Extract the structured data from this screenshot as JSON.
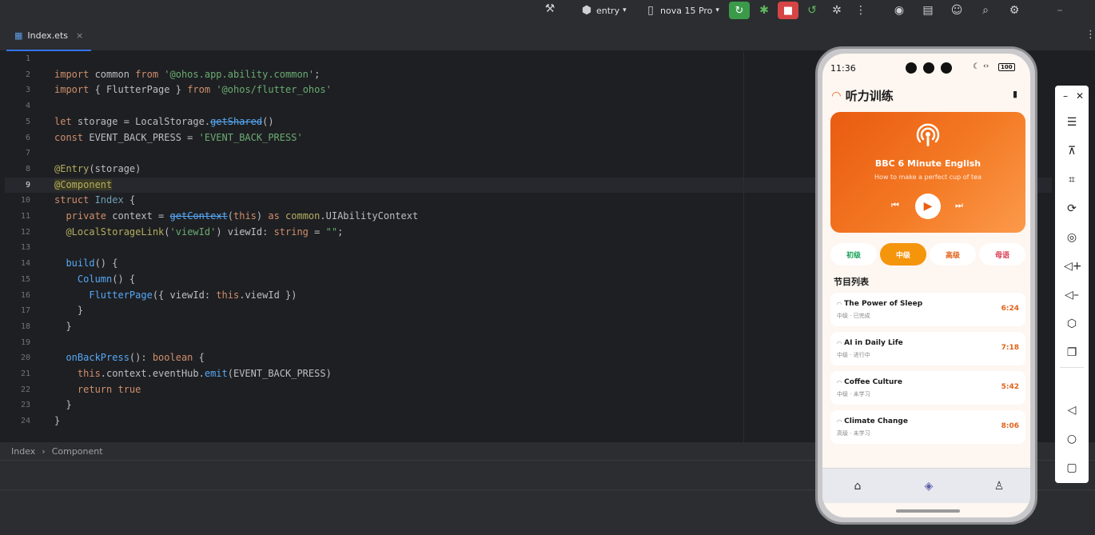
{
  "toolbar": {
    "module": "entry",
    "device": "nova 15 Pro"
  },
  "tab": {
    "filename": "Index.ets",
    "close": "×"
  },
  "gutter": [
    "1",
    "2",
    "3",
    "4",
    "5",
    "6",
    "7",
    "8",
    "9",
    "10",
    "11",
    "12",
    "13",
    "14",
    "15",
    "16",
    "17",
    "18",
    "19",
    "20",
    "21",
    "22",
    "23",
    "24"
  ],
  "code": {
    "l2": {
      "kw1": "import",
      "a": " common ",
      "kw2": "from",
      "s": " '@ohos.app.ability.common'",
      "e": ";"
    },
    "l3": {
      "kw1": "import",
      "a": " { FlutterPage } ",
      "kw2": "from",
      "s": " '@ohos/flutter_ohos'"
    },
    "l5": {
      "kw1": "let",
      "a": " storage = LocalStorage.",
      "fn": "getShared",
      "e": "()"
    },
    "l6": {
      "kw1": "const",
      "a": " EVENT_BACK_PRESS = ",
      "s": "'EVENT_BACK_PRESS'"
    },
    "l8": {
      "ann": "@Entry",
      "a": "(storage)"
    },
    "l9": {
      "ann": "@Component"
    },
    "l10": {
      "kw1": "struct",
      "ty": " Index",
      "a": " {"
    },
    "l11": {
      "kw1": "  private",
      "a": " context = ",
      "fn": "getContext",
      "b": "(",
      "kw2": "this",
      "c": ") ",
      "kw3": "as",
      "ty": " common",
      "d": ".UIAbilityContext"
    },
    "l12": {
      "ann": "  @LocalStorageLink",
      "a": "(",
      "s": "'viewId'",
      "b": ") viewId: ",
      "kw1": "string",
      "c": " = ",
      "s2": "\"\"",
      "e": ";"
    },
    "l14": {
      "fn": "  build",
      "a": "() {"
    },
    "l15": {
      "fn": "    Column",
      "a": "() {"
    },
    "l16": {
      "fn": "      FlutterPage",
      "a": "({ viewId: ",
      "kw1": "this",
      "b": ".viewId })"
    },
    "l17": {
      "a": "    }"
    },
    "l18": {
      "a": "  }"
    },
    "l20": {
      "fn": "  onBackPress",
      "a": "(): ",
      "kw1": "boolean",
      "b": " {"
    },
    "l21": {
      "kw1": "    this",
      "a": ".context.eventHub.",
      "fn": "emit",
      "b": "(EVENT_BACK_PRESS)"
    },
    "l22": {
      "kw1": "    return",
      "kw2": " true"
    },
    "l23": {
      "a": "  }"
    },
    "l24": {
      "a": "}"
    }
  },
  "statusbar": {
    "crumb1": "Index",
    "sep": "›",
    "crumb2": "Component"
  },
  "phone": {
    "time": "11:36",
    "battery": "100",
    "app_title": "听力训练",
    "hero": {
      "title": "BBC 6 Minute English",
      "subtitle": "How to make a perfect cup of tea"
    },
    "levels": [
      {
        "label": "初级",
        "color": "#1aa35a"
      },
      {
        "label": "中级",
        "color": "#ffffff"
      },
      {
        "label": "高级",
        "color": "#e0621a"
      },
      {
        "label": "母语",
        "color": "#d9324a"
      }
    ],
    "section_title": "节目列表",
    "episodes": [
      {
        "title": "The Power of Sleep",
        "meta": "中级 · 已完成",
        "duration": "6:24"
      },
      {
        "title": "AI in Daily Life",
        "meta": "中级 · 进行中",
        "duration": "7:18"
      },
      {
        "title": "Coffee Culture",
        "meta": "中级 · 未学习",
        "duration": "5:42"
      },
      {
        "title": "Climate Change",
        "meta": "高级 · 未学习",
        "duration": "8:06"
      }
    ],
    "nav": [
      "home-icon",
      "compass-icon",
      "user-icon"
    ]
  },
  "colors": {
    "accent": "#e95b10",
    "ide_bg": "#1e1f22"
  }
}
